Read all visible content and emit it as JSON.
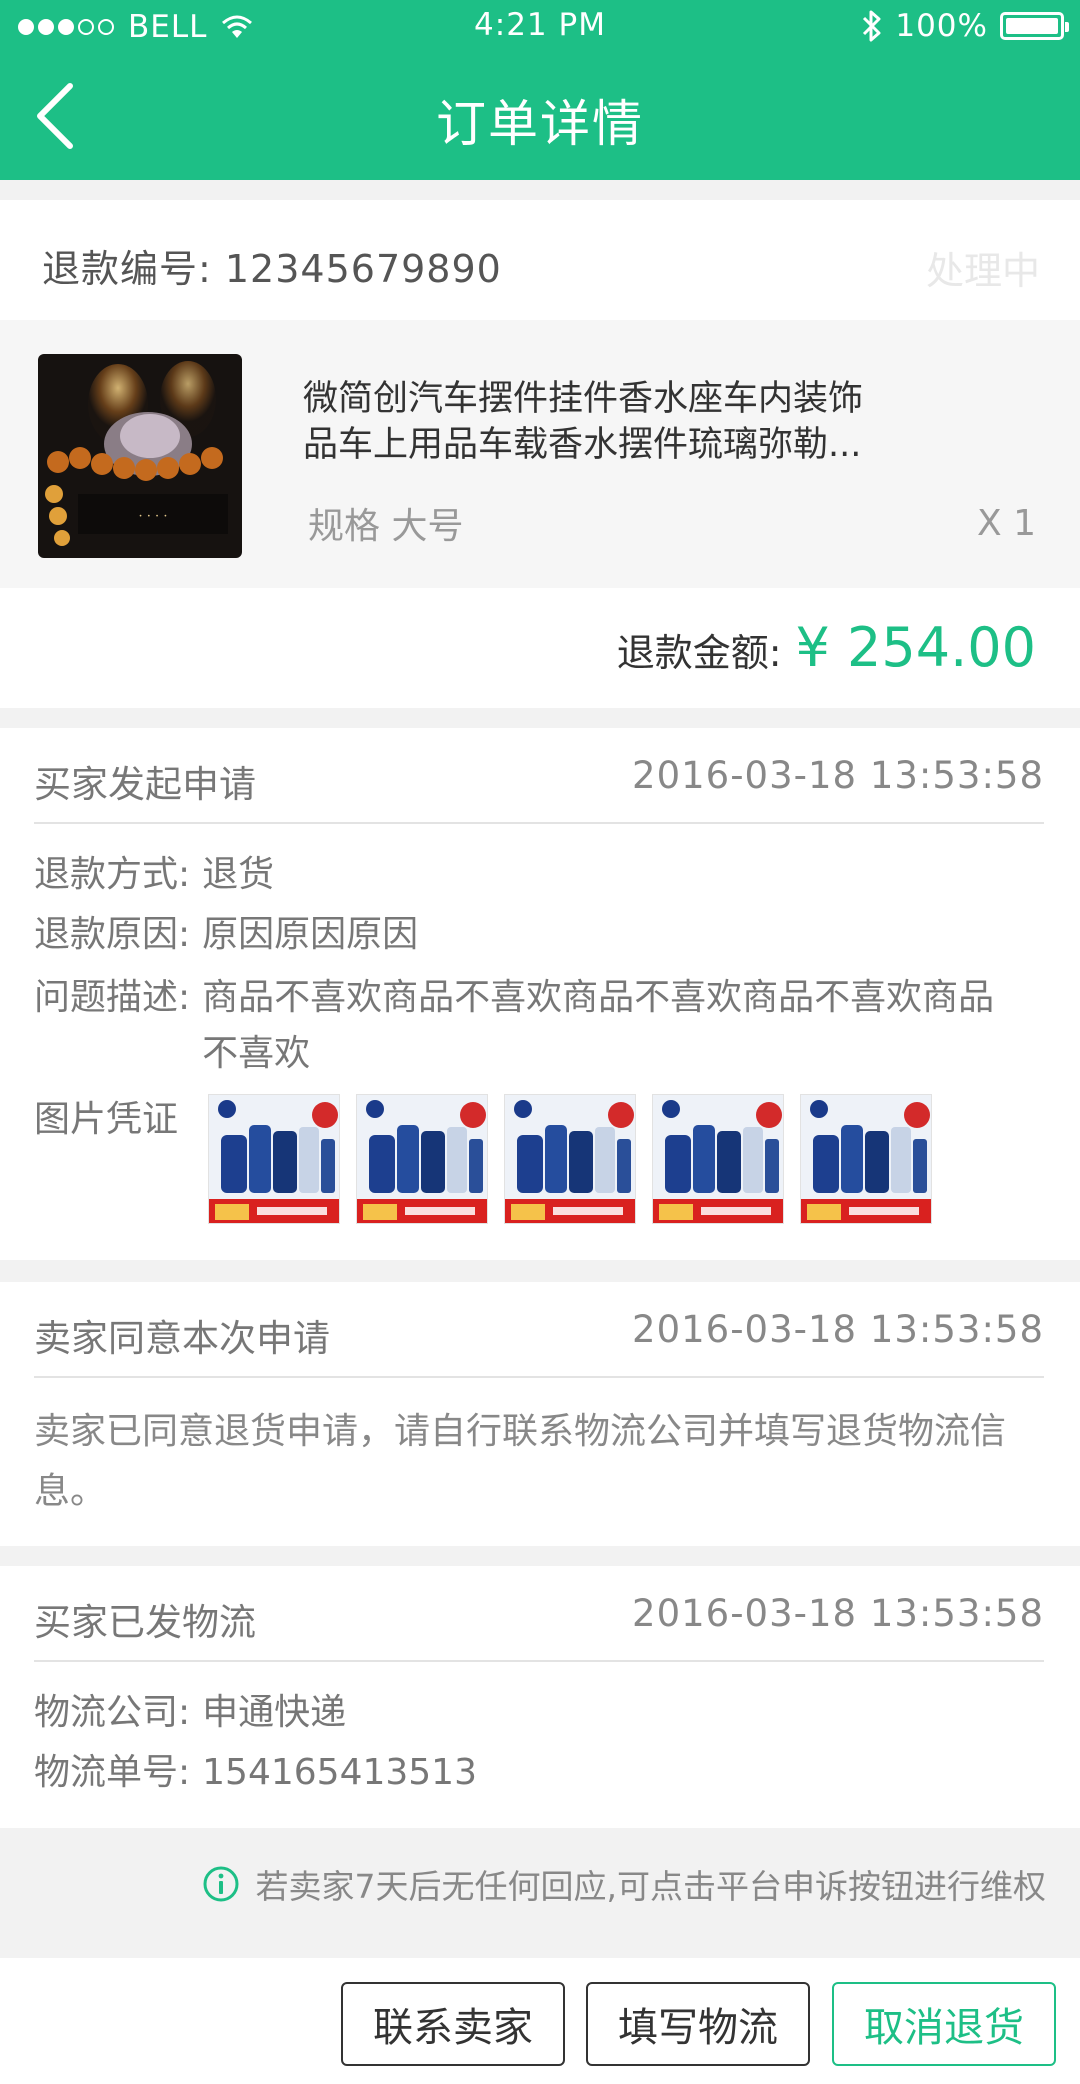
{
  "status_bar": {
    "carrier": "BELL",
    "time": "4:21 PM",
    "battery": "100%"
  },
  "nav": {
    "title": "订单详情",
    "back_icon": "chevron-left-icon"
  },
  "refund": {
    "number_text": "退款编号: 12345679890",
    "status": "处理中"
  },
  "product": {
    "title_line1": "微简创汽车摆件挂件香水座车内装饰",
    "title_line2": "品车上用品车载香水摆件琉璃弥勒...",
    "spec": "规格 大号",
    "qty": "X 1"
  },
  "amount": {
    "label": "退款金额:",
    "value": "¥ 254.00"
  },
  "timeline": [
    {
      "title": "买家发起申请",
      "time": "2016-03-18 13:53:58",
      "method_key": "退款方式:",
      "method_val": "退货",
      "reason_key": "退款原因:",
      "reason_val": "原因原因原因",
      "desc_key": "问题描述:",
      "desc_val": "商品不喜欢商品不喜欢商品不喜欢商品不喜欢商品不喜欢",
      "evidence_label": "图片凭证"
    },
    {
      "title": "卖家同意本次申请",
      "time": "2016-03-18 13:53:58",
      "text": "卖家已同意退货申请，请自行联系物流公司并填写退货物流信息。"
    },
    {
      "title": "买家已发物流",
      "time": "2016-03-18 13:53:58",
      "company_key": "物流公司:",
      "company_val": "申通快递",
      "tracking_key": "物流单号:",
      "tracking_val": "154165413513"
    }
  ],
  "tip": {
    "icon": "info-icon",
    "text": "若卖家7天后无任何回应,可点击平台申诉按钮进行维权"
  },
  "actions": {
    "contact_seller": "联系卖家",
    "fill_logistics": "填写物流",
    "cancel_return": "取消退货"
  },
  "colors": {
    "brand": "#1dbf86"
  }
}
